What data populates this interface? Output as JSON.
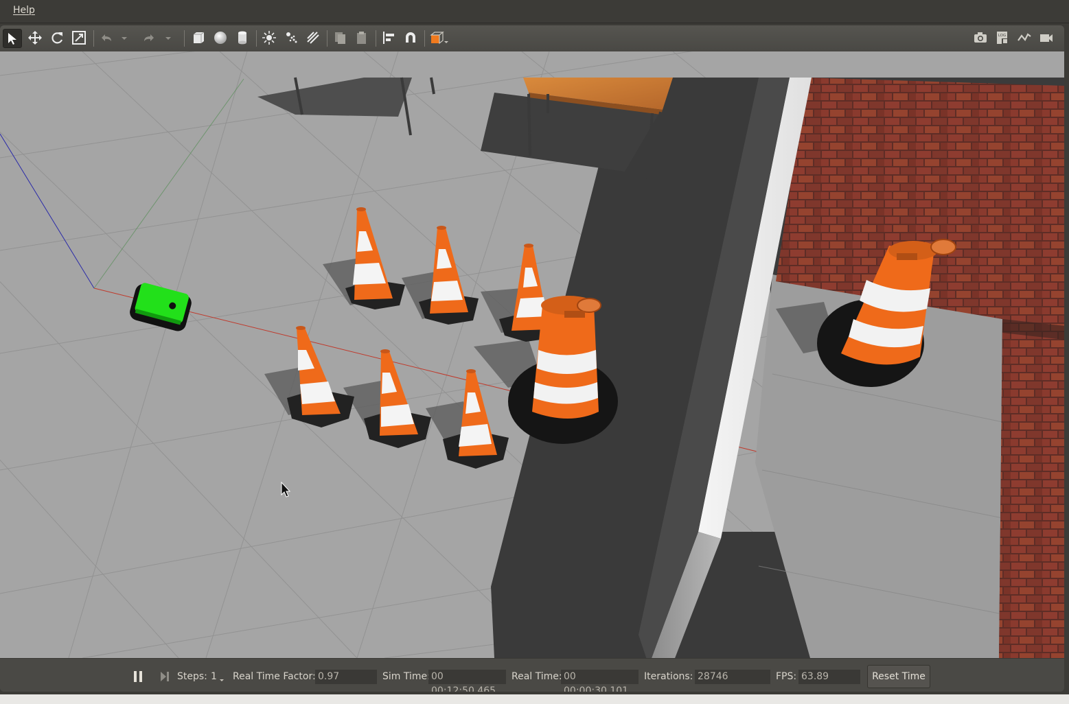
{
  "menu": {
    "help_label": "Help"
  },
  "toolbar": {
    "left_icons": [
      "select-arrow-icon",
      "translate-icon",
      "rotate-icon",
      "scale-icon",
      "undo-icon",
      "undo-dropdown-icon",
      "redo-icon",
      "redo-dropdown-icon",
      "box-shape-icon",
      "sphere-shape-icon",
      "cylinder-shape-icon",
      "point-light-icon",
      "spot-light-icon",
      "directional-light-icon",
      "copy-icon",
      "paste-icon",
      "align-icon",
      "snap-magnet-icon",
      "view-angle-icon"
    ],
    "right_icons": [
      "screenshot-camera-icon",
      "log-icon",
      "plot-icon",
      "video-record-icon"
    ],
    "accent_color": "#f07a1e"
  },
  "status": {
    "steps_label": "Steps:",
    "steps_value": "1",
    "rtf_label": "Real Time Factor:",
    "rtf_value": "0.97",
    "sim_time_label": "Sim Time:",
    "sim_time_value": "00 00:12:50.465",
    "real_time_label": "Real Time:",
    "real_time_value": "00 00:00:30.101",
    "iterations_label": "Iterations:",
    "iterations_value": "28746",
    "fps_label": "FPS:",
    "fps_value": "63.89",
    "reset_time_label": "Reset Time"
  },
  "scene": {
    "robot_color": "#22e01a",
    "cone_color": "#ef6a1a",
    "stripe_color": "#f4f4f4"
  }
}
